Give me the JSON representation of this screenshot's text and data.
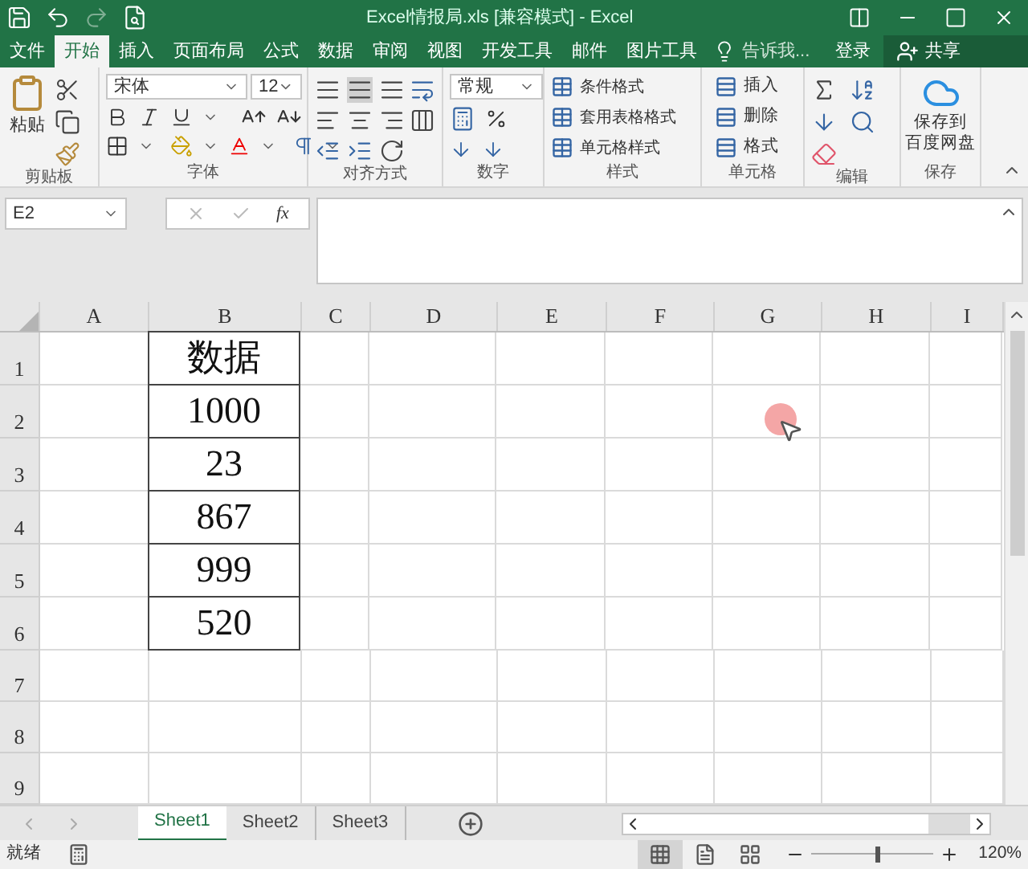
{
  "title": "Excel情报局.xls  [兼容模式] - Excel",
  "tabs": [
    {
      "label": "文件",
      "selected": false
    },
    {
      "label": "开始",
      "selected": true
    },
    {
      "label": "插入",
      "selected": false
    },
    {
      "label": "页面布局",
      "selected": false
    },
    {
      "label": "公式",
      "selected": false
    },
    {
      "label": "数据",
      "selected": false
    },
    {
      "label": "审阅",
      "selected": false
    },
    {
      "label": "视图",
      "selected": false
    },
    {
      "label": "开发工具",
      "selected": false
    },
    {
      "label": "邮件",
      "selected": false
    },
    {
      "label": "图片工具",
      "selected": false
    }
  ],
  "tell_me": "告诉我...",
  "login": "登录",
  "share": "共享",
  "ribbon": {
    "clipboard": {
      "paste": "粘贴",
      "label": "剪贴板"
    },
    "font": {
      "name": "宋体",
      "size": "12",
      "label": "字体"
    },
    "alignment": {
      "label": "对齐方式"
    },
    "number": {
      "format": "常规",
      "label": "数字"
    },
    "styles": {
      "items": [
        "条件格式",
        "套用表格格式",
        "单元格样式"
      ],
      "label": "样式"
    },
    "cells": {
      "items": [
        "插入",
        "删除",
        "格式"
      ],
      "label": "单元格"
    },
    "editing": {
      "label": "编辑"
    },
    "save": {
      "button": [
        "保存到",
        "百度网盘"
      ],
      "label": "保存"
    }
  },
  "formula_bar": {
    "name_box": "E2",
    "fx": "fx"
  },
  "sheet": {
    "columns": [
      "A",
      "B",
      "C",
      "D",
      "E",
      "F",
      "G",
      "H",
      "I"
    ],
    "rows": [
      {
        "header": "1",
        "b": "数据"
      },
      {
        "header": "2",
        "b": "1000"
      },
      {
        "header": "3",
        "b": "23"
      },
      {
        "header": "4",
        "b": "867"
      },
      {
        "header": "5",
        "b": "999"
      },
      {
        "header": "6",
        "b": "520"
      },
      {
        "header": "7"
      },
      {
        "header": "8"
      },
      {
        "header": "9"
      }
    ]
  },
  "sheet_tabs": [
    {
      "label": "Sheet1",
      "selected": true
    },
    {
      "label": "Sheet2",
      "selected": false
    },
    {
      "label": "Sheet3",
      "selected": false
    }
  ],
  "status": "就绪",
  "views": [
    {
      "kind": "normal",
      "selected": true
    },
    {
      "kind": "page_layout",
      "selected": false
    },
    {
      "kind": "page_break",
      "selected": false
    }
  ],
  "zoom": {
    "level": 0.54,
    "reading": "120%"
  }
}
